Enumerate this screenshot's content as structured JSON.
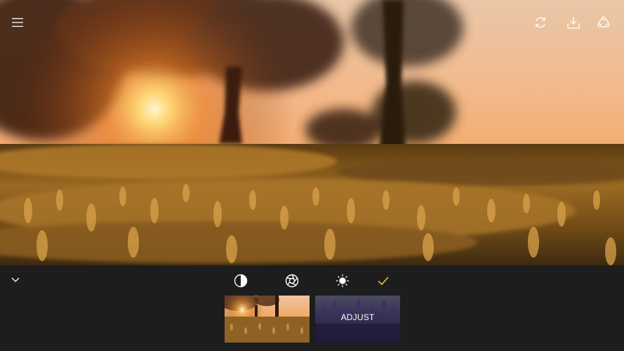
{
  "photo": {
    "subject": "sunset-meadow"
  },
  "toolbar": {
    "menu_icon": "hamburger-icon",
    "actions": [
      {
        "icon": "rotate-icon"
      },
      {
        "icon": "download-icon"
      },
      {
        "icon": "share-icon"
      }
    ]
  },
  "edit_panel": {
    "collapse_icon": "chevron-down-icon",
    "tools": [
      {
        "icon": "contrast-icon"
      },
      {
        "icon": "aperture-icon"
      },
      {
        "icon": "brightness-icon"
      },
      {
        "icon": "checkmark-icon",
        "color": "#f5c518"
      }
    ],
    "thumbnails": [
      {
        "label": ""
      },
      {
        "label": "ADJUST"
      }
    ]
  },
  "colors": {
    "panel_bg": "#1d1d1d",
    "accent": "#f5c518",
    "icon": "#ffffff"
  }
}
